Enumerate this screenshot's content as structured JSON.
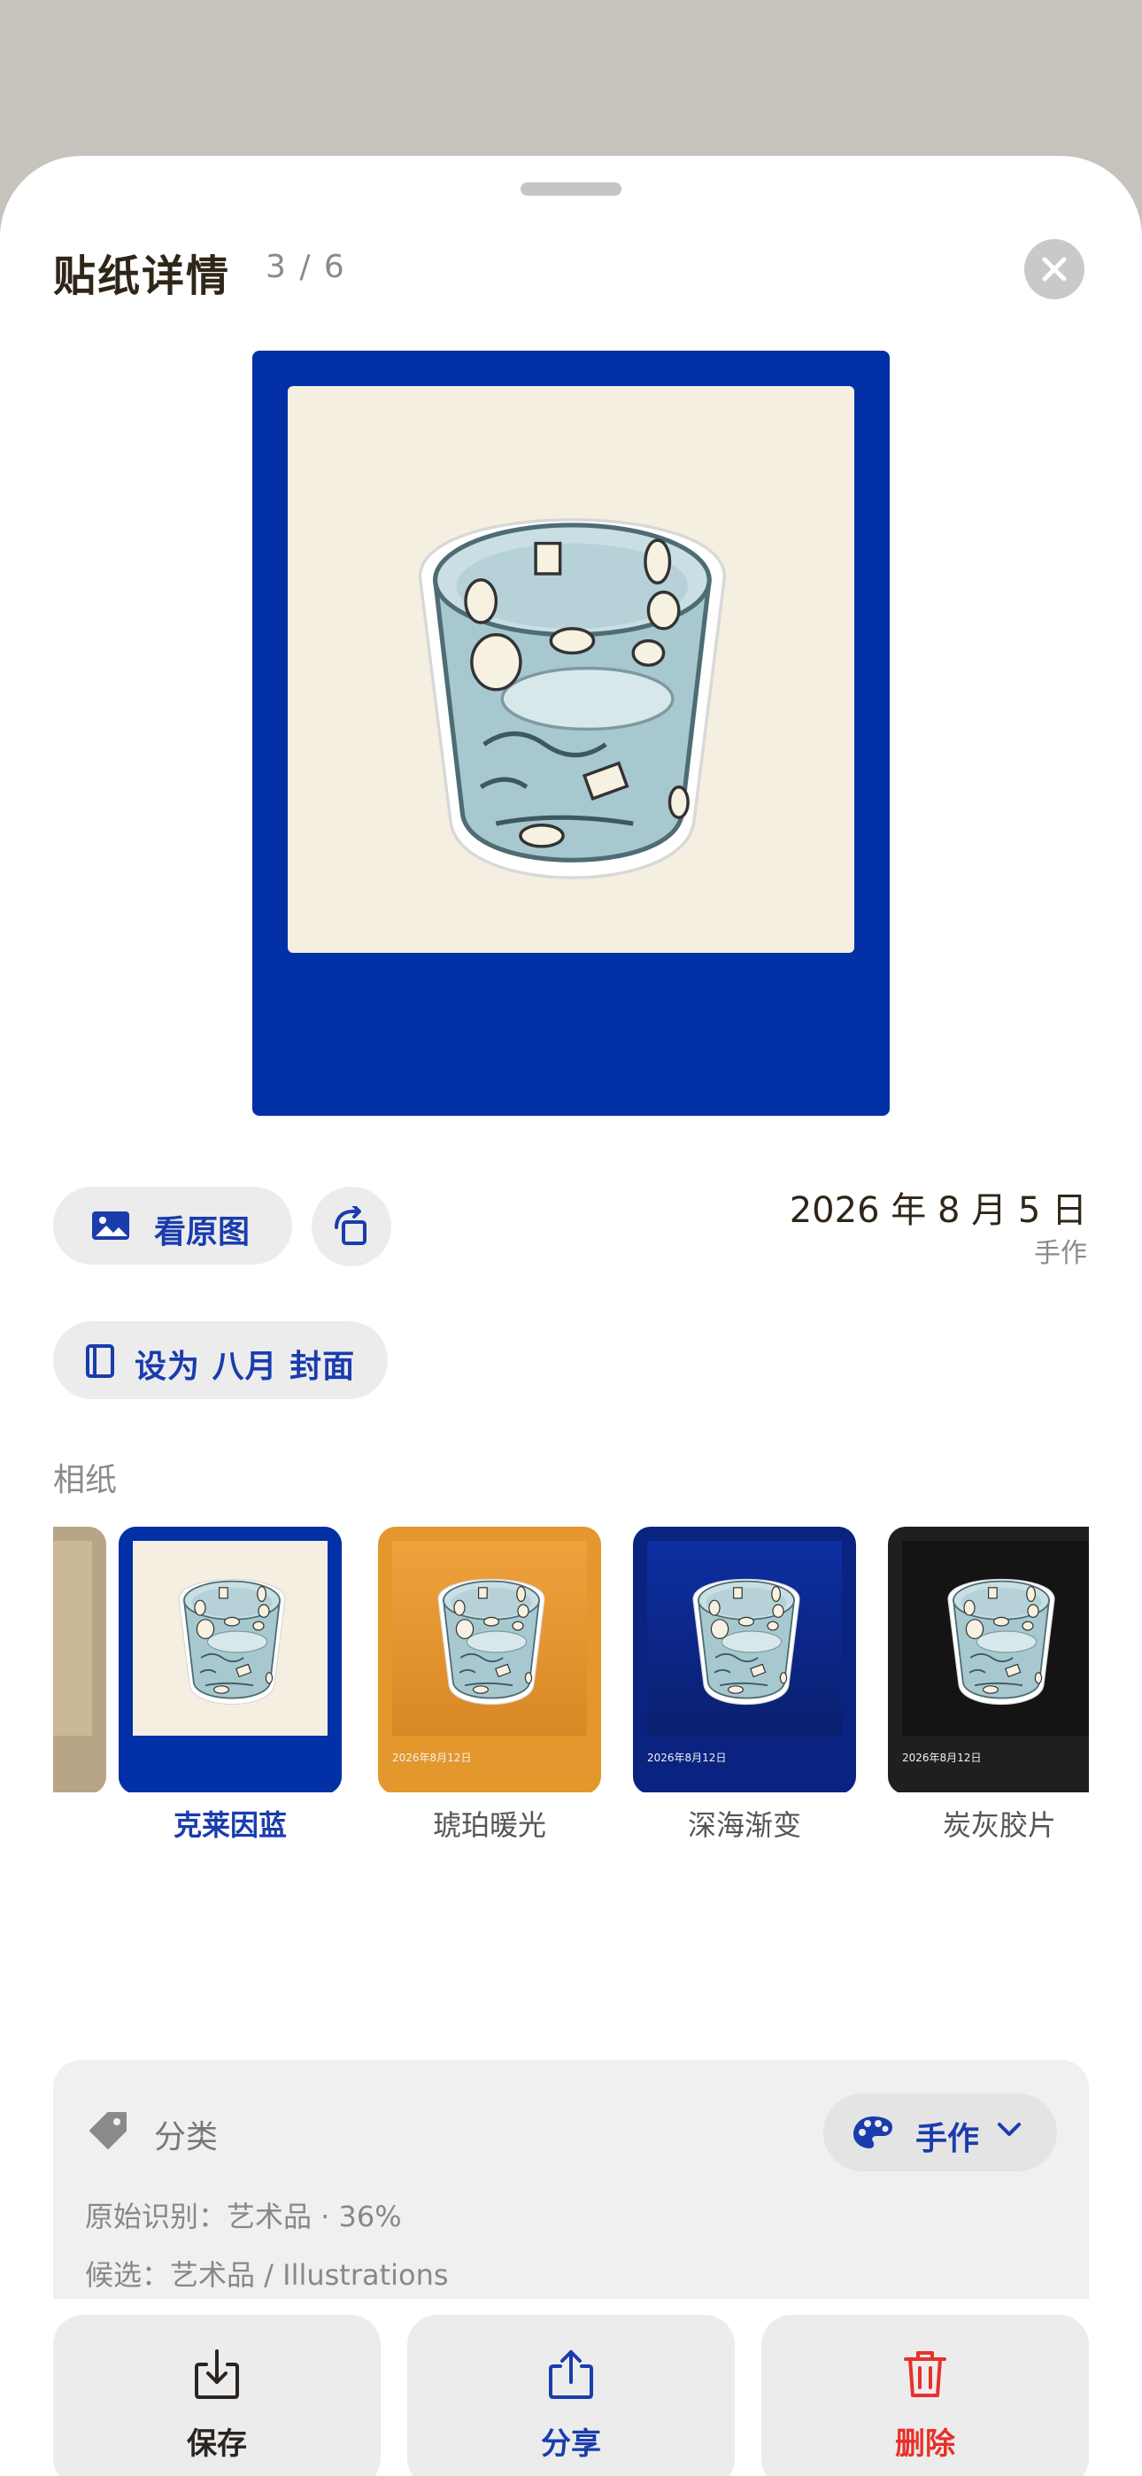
{
  "header": {
    "title": "贴纸详情",
    "counter": "3 / 6"
  },
  "actions_top": {
    "view_original": "看原图",
    "set_cover": "设为 八月 封面",
    "date": "2026 年 8 月 5 日",
    "date_sub": "手作"
  },
  "paper": {
    "label": "相纸",
    "options": [
      {
        "label": "克莱因蓝",
        "selected": true,
        "color": "#0230a6"
      },
      {
        "label": "琥珀暖光",
        "selected": false,
        "color": "#e3972c"
      },
      {
        "label": "深海渐变",
        "selected": false,
        "color": "#0a2380"
      },
      {
        "label": "炭灰胶片",
        "selected": false,
        "color": "#1f1f1f"
      }
    ],
    "thumb_date": "2026年8月12日"
  },
  "category": {
    "title": "分类",
    "value": "手作",
    "original": "原始识别：艺术品 · 36%",
    "candidates": "候选：艺术品 / Illustrations"
  },
  "bottom_actions": {
    "save": "保存",
    "share": "分享",
    "delete": "删除"
  },
  "colors": {
    "accent": "#1a3cad",
    "klein_blue": "#0230a6",
    "delete_red": "#e8302a"
  }
}
